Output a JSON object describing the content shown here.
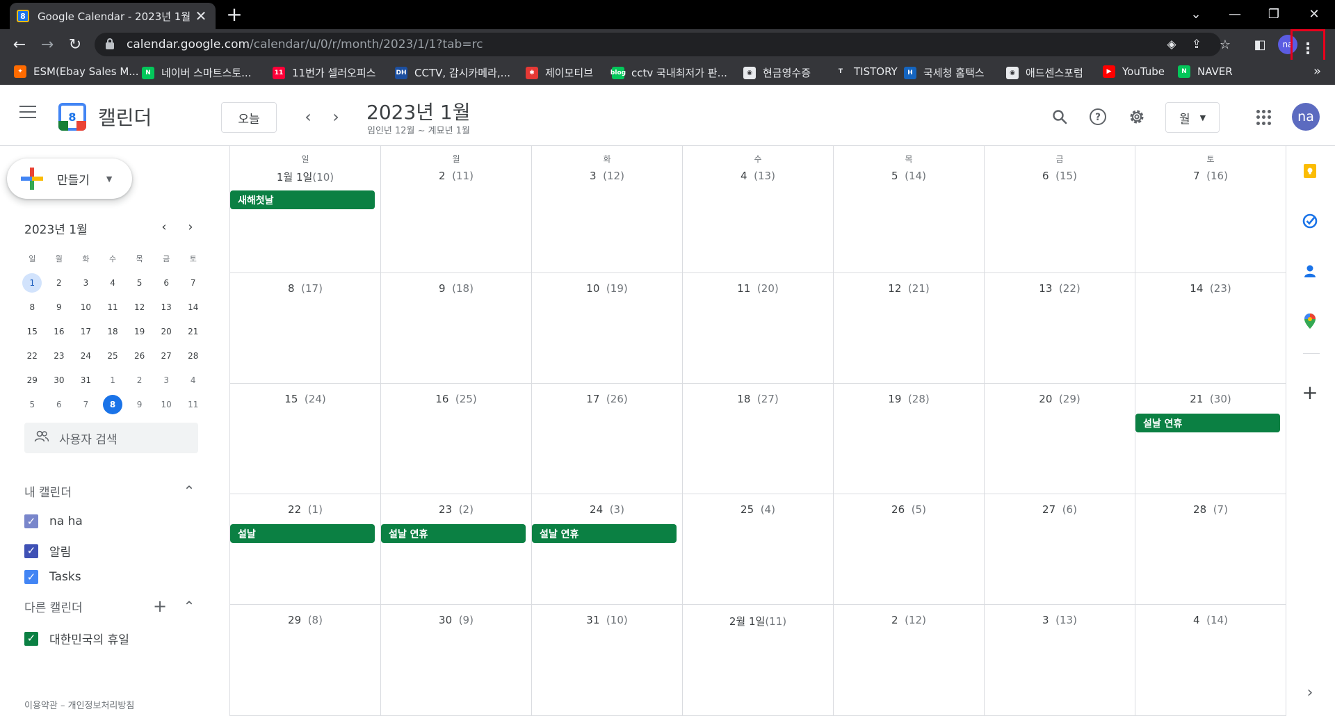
{
  "browser": {
    "tab_title": "Google Calendar - 2023년 1월",
    "tab_favicon": "8",
    "url_host": "calendar.google.com",
    "url_path": "/calendar/u/0/r/month/2023/1/1?tab=rc",
    "profile_initials": "na",
    "bookmarks": [
      {
        "label": "ESM(Ebay Sales M...",
        "color": "#ff6b00",
        "glyph": "✦"
      },
      {
        "label": "네이버 스마트스토...",
        "color": "#03c75a",
        "glyph": "N"
      },
      {
        "label": "11번가 셀러오피스",
        "color": "#ff0038",
        "glyph": "11"
      },
      {
        "label": "CCTV, 감시카메라,...",
        "color": "#1c4fa0",
        "glyph": "DH"
      },
      {
        "label": "제이모티브",
        "color": "#e53935",
        "glyph": "✱"
      },
      {
        "label": "cctv 국내최저가 판...",
        "color": "#03c75a",
        "glyph": "blog"
      },
      {
        "label": "현금영수증",
        "color": "#e8eaed",
        "glyph": "◉"
      },
      {
        "label": "TISTORY",
        "color": "#35363a",
        "glyph": "T"
      },
      {
        "label": "국세청 홈택스",
        "color": "#1565c0",
        "glyph": "H"
      },
      {
        "label": "애드센스포럼",
        "color": "#e8eaed",
        "glyph": "◉"
      },
      {
        "label": "YouTube",
        "color": "#ff0000",
        "glyph": "▶"
      },
      {
        "label": "NAVER",
        "color": "#03c75a",
        "glyph": "N"
      }
    ],
    "bookmarks_more": "»"
  },
  "header": {
    "app_name": "캘린더",
    "logo_day": "8",
    "today_label": "오늘",
    "month_title": "2023년 1월",
    "lunar_range": "임인년 12월 ~ 계묘년 1월",
    "view_label": "월",
    "avatar_initials": "na"
  },
  "sidebar": {
    "create_label": "만들기",
    "mini_month_title": "2023년 1월",
    "weekday_headers": [
      "일",
      "월",
      "화",
      "수",
      "목",
      "금",
      "토"
    ],
    "mini_weeks": [
      [
        "1",
        "2",
        "3",
        "4",
        "5",
        "6",
        "7"
      ],
      [
        "8",
        "9",
        "10",
        "11",
        "12",
        "13",
        "14"
      ],
      [
        "15",
        "16",
        "17",
        "18",
        "19",
        "20",
        "21"
      ],
      [
        "22",
        "23",
        "24",
        "25",
        "26",
        "27",
        "28"
      ],
      [
        "29",
        "30",
        "31",
        "1",
        "2",
        "3",
        "4"
      ],
      [
        "5",
        "6",
        "7",
        "8",
        "9",
        "10",
        "11"
      ]
    ],
    "people_search_label": "사용자 검색",
    "my_calendars_title": "내 캘린더",
    "my_calendars": [
      {
        "label": "na ha",
        "color": "#7986cb"
      },
      {
        "label": "알림",
        "color": "#3f51b5"
      },
      {
        "label": "Tasks",
        "color": "#4285f4"
      }
    ],
    "other_calendars_title": "다른 캘린더",
    "other_calendars": [
      {
        "label": "대한민국의 휴일",
        "color": "#0b8043"
      }
    ],
    "footer": "이용약관 – 개인정보처리방침"
  },
  "month": {
    "weekdays": [
      "일",
      "월",
      "화",
      "수",
      "목",
      "금",
      "토"
    ],
    "weeks": [
      [
        {
          "day": "1월 1일",
          "lunar": "(10)",
          "events": [
            "새해첫날"
          ]
        },
        {
          "day": "2",
          "lunar": "(11)",
          "events": []
        },
        {
          "day": "3",
          "lunar": "(12)",
          "events": []
        },
        {
          "day": "4",
          "lunar": "(13)",
          "events": []
        },
        {
          "day": "5",
          "lunar": "(14)",
          "events": []
        },
        {
          "day": "6",
          "lunar": "(15)",
          "events": []
        },
        {
          "day": "7",
          "lunar": "(16)",
          "events": []
        }
      ],
      [
        {
          "day": "8",
          "lunar": "(17)",
          "events": []
        },
        {
          "day": "9",
          "lunar": "(18)",
          "events": []
        },
        {
          "day": "10",
          "lunar": "(19)",
          "events": []
        },
        {
          "day": "11",
          "lunar": "(20)",
          "events": []
        },
        {
          "day": "12",
          "lunar": "(21)",
          "events": []
        },
        {
          "day": "13",
          "lunar": "(22)",
          "events": []
        },
        {
          "day": "14",
          "lunar": "(23)",
          "events": []
        }
      ],
      [
        {
          "day": "15",
          "lunar": "(24)",
          "events": []
        },
        {
          "day": "16",
          "lunar": "(25)",
          "events": []
        },
        {
          "day": "17",
          "lunar": "(26)",
          "events": []
        },
        {
          "day": "18",
          "lunar": "(27)",
          "events": []
        },
        {
          "day": "19",
          "lunar": "(28)",
          "events": []
        },
        {
          "day": "20",
          "lunar": "(29)",
          "events": []
        },
        {
          "day": "21",
          "lunar": "(30)",
          "events": [
            "설날 연휴"
          ]
        }
      ],
      [
        {
          "day": "22",
          "lunar": "(1)",
          "events": [
            "설날"
          ]
        },
        {
          "day": "23",
          "lunar": "(2)",
          "events": [
            "설날 연휴"
          ]
        },
        {
          "day": "24",
          "lunar": "(3)",
          "events": [
            "설날 연휴"
          ]
        },
        {
          "day": "25",
          "lunar": "(4)",
          "events": []
        },
        {
          "day": "26",
          "lunar": "(5)",
          "events": []
        },
        {
          "day": "27",
          "lunar": "(6)",
          "events": []
        },
        {
          "day": "28",
          "lunar": "(7)",
          "events": []
        }
      ],
      [
        {
          "day": "29",
          "lunar": "(8)",
          "events": []
        },
        {
          "day": "30",
          "lunar": "(9)",
          "events": []
        },
        {
          "day": "31",
          "lunar": "(10)",
          "events": []
        },
        {
          "day": "2월 1일",
          "lunar": "(11)",
          "events": []
        },
        {
          "day": "2",
          "lunar": "(12)",
          "events": []
        },
        {
          "day": "3",
          "lunar": "(13)",
          "events": []
        },
        {
          "day": "4",
          "lunar": "(14)",
          "events": []
        }
      ]
    ]
  },
  "colors": {
    "event_green": "#0b8043",
    "accent_blue": "#1a73e8",
    "highlight_red": "#e8001c"
  }
}
